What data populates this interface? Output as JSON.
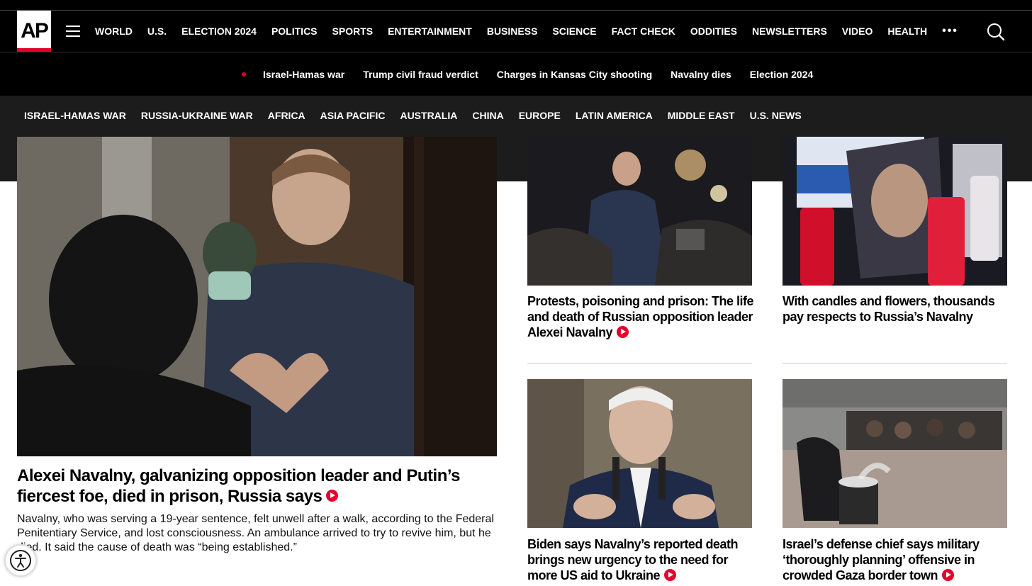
{
  "logo": {
    "text": "AP"
  },
  "main_nav": [
    "WORLD",
    "U.S.",
    "ELECTION 2024",
    "POLITICS",
    "SPORTS",
    "ENTERTAINMENT",
    "BUSINESS",
    "SCIENCE",
    "FACT CHECK",
    "ODDITIES",
    "NEWSLETTERS",
    "VIDEO",
    "HEALTH"
  ],
  "more_label": "•••",
  "trending": [
    "Israel-Hamas war",
    "Trump civil fraud verdict",
    "Charges in Kansas City shooting",
    "Navalny dies",
    "Election 2024"
  ],
  "sub_nav": [
    "ISRAEL-HAMAS WAR",
    "RUSSIA-UKRAINE WAR",
    "AFRICA",
    "ASIA PACIFIC",
    "AUSTRALIA",
    "CHINA",
    "EUROPE",
    "LATIN AMERICA",
    "MIDDLE EAST",
    "U.S. NEWS"
  ],
  "lead": {
    "headline": "Alexei Navalny, galvanizing opposition leader and Putin’s fiercest foe, died in prison, Russia says",
    "summary": "Navalny, who was serving a 19-year sentence, felt unwell after a walk, according to the Federal Penitentiary Service, and lost consciousness. An ambulance arrived to try to revive him, but he died. It said the cause of death was “being established.”",
    "has_video": true
  },
  "stories": [
    {
      "headline": "Protests, poisoning and prison: The life and death of Russian opposition leader Alexei Navalny",
      "has_video": true
    },
    {
      "headline": "With candles and flowers, thousands pay respects to Russia’s Navalny",
      "has_video": false
    },
    {
      "headline": "Biden says Navalny’s reported death brings new urgency to the need for more US aid to Ukraine",
      "has_video": true
    },
    {
      "headline": "Israel’s defense chief says military ‘thoroughly planning’ offensive in crowded Gaza border town",
      "has_video": true
    }
  ],
  "colors": {
    "brand_red": "#e4002b",
    "nav_bg": "#000000",
    "subnav_bg": "#1c1c1c"
  }
}
